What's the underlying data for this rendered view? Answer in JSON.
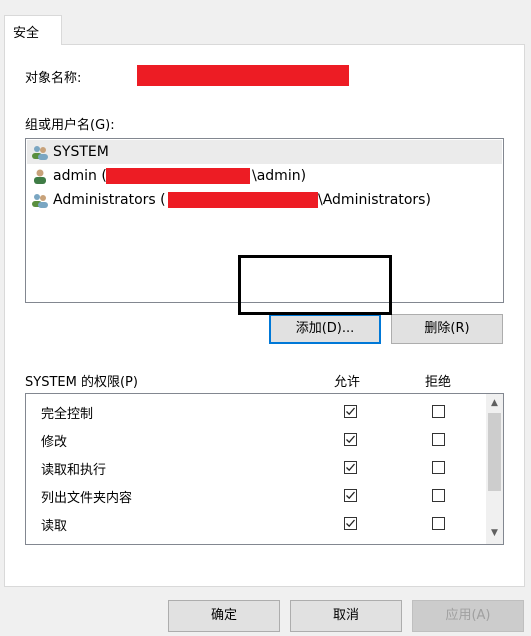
{
  "tab": {
    "label": "安全"
  },
  "object_name": {
    "label": "对象名称:"
  },
  "groups": {
    "label": "组或用户名(G):",
    "items": [
      {
        "name": "SYSTEM",
        "suffix": "",
        "icon": "group-users-icon",
        "selected": true
      },
      {
        "name": "admin (",
        "suffix": "\\admin)",
        "icon": "user-icon",
        "selected": false
      },
      {
        "name": "Administrators (",
        "suffix": "\\Administrators)",
        "icon": "group-users-icon",
        "selected": false
      }
    ]
  },
  "buttons": {
    "add": "添加(D)...",
    "remove": "删除(R)"
  },
  "permissions": {
    "label": "SYSTEM 的权限(P)",
    "allow_header": "允许",
    "deny_header": "拒绝",
    "rows": [
      {
        "name": "完全控制",
        "allow": true,
        "deny": false
      },
      {
        "name": "修改",
        "allow": true,
        "deny": false
      },
      {
        "name": "读取和执行",
        "allow": true,
        "deny": false
      },
      {
        "name": "列出文件夹内容",
        "allow": true,
        "deny": false
      },
      {
        "name": "读取",
        "allow": true,
        "deny": false
      }
    ]
  },
  "footer": {
    "ok": "确定",
    "cancel": "取消",
    "apply": "应用(A)"
  },
  "colors": {
    "redaction": "#ed1c24",
    "focus": "#0078d7",
    "highlight_box": "#000000"
  }
}
